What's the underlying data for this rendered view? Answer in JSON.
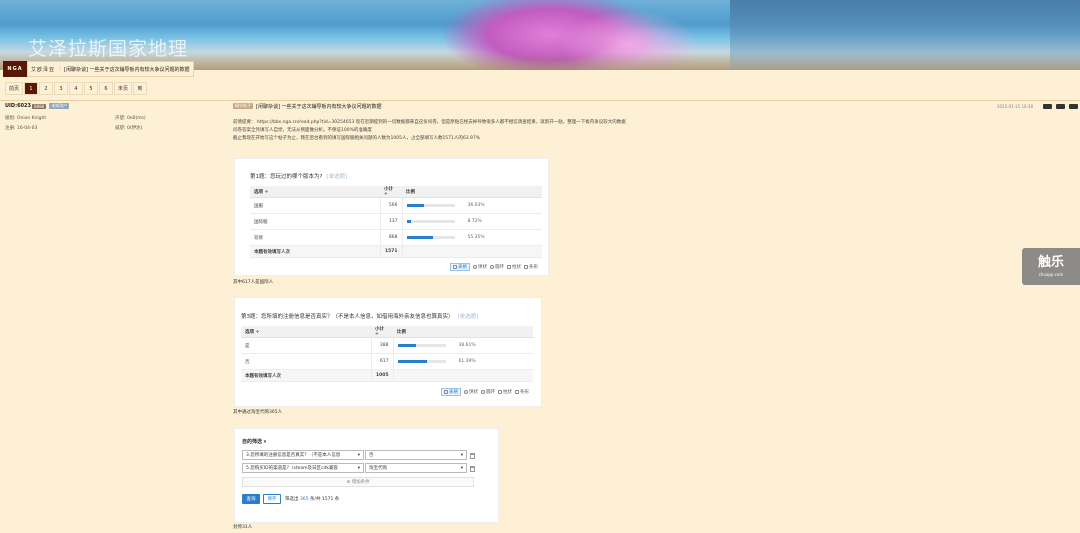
{
  "banner": {
    "site_title": "艾泽拉斯国家地理"
  },
  "header": {
    "logo": "NGA",
    "forum": "艾欧泽亚",
    "thread_title": "[闲聊杂谈] 一些关于这次辅导板内有较大争议问题的数据"
  },
  "pager": {
    "first": "前页",
    "pages": [
      "1",
      "2",
      "3",
      "4",
      "5",
      "6"
    ],
    "last": "末页",
    "to": "到"
  },
  "user": {
    "uid": "UID:6023",
    "badge": "8888",
    "badge2": "未知用户",
    "fields": [
      {
        "k": "级别",
        "v": "Onion Knight"
      },
      {
        "k": "声望",
        "v": "0e0(ms)"
      },
      {
        "k": "注册",
        "v": "16-04-03"
      },
      {
        "k": "威望",
        "v": "0(伊达)"
      }
    ]
  },
  "post": {
    "tag": "精华帖子",
    "title": "[闲聊杂谈] 一些关于这次辅导板内有较大争议问题的数据",
    "date": "2022-01-15 16:38",
    "lines": [
      "前情提要： https://bbs.nga.cn/read.php?tid=30254653 现在近期提到的一切数据都来自这份问卷。但是原贴已经去掉导致很多人都不相信调查结果，就新开一贴，整理一下板内争议较大的数据",
      "问卷答案全凭填写人自觉，无法从侧面做分析。不保证100%的准确度",
      "截止我现在开始写这个帖子为止，我在后台看到的填写国际服相关问题的人数为1005人，占全部填写人数1571人的63.97%"
    ]
  },
  "poll1": {
    "question": "第1题：您玩过的哪个版本为?",
    "kind": "[单选题]",
    "headers": [
      "选项 ÷",
      "小计 ÷",
      "比例"
    ],
    "rows": [
      {
        "option": "国服",
        "count": "566",
        "pct": "36.03%",
        "ratio": 0.3603
      },
      {
        "option": "国际服",
        "count": "137",
        "pct": "8.72%",
        "ratio": 0.0872
      },
      {
        "option": "双修",
        "count": "868",
        "pct": "55.25%",
        "ratio": 0.5525
      }
    ],
    "total_label": "本题有效填写人次",
    "total": "1571",
    "views": [
      "表格",
      "饼状",
      "圆环",
      "柱状",
      "条形"
    ]
  },
  "note1": "其中617人是国际人",
  "poll2": {
    "question": "第3题：您所填的注册信息是否真实？（不是本人信息，如借用海外亲友信息也算真实）",
    "kind": "[单选题]",
    "headers": [
      "选项 ÷",
      "小计 ÷",
      "比例"
    ],
    "rows": [
      {
        "option": "是",
        "count": "388",
        "pct": "38.61%",
        "ratio": 0.3861
      },
      {
        "option": "否",
        "count": "617",
        "pct": "61.39%",
        "ratio": 0.6139
      }
    ],
    "total_label": "本题有效填写人次",
    "total": "1005",
    "views": [
      "表格",
      "饼状",
      "圆环",
      "柱状",
      "条形"
    ]
  },
  "note2": "其中通过淘宝代购365人",
  "filter": {
    "title": "自的筛选 ▾",
    "cond1_q": "3.您所填的注册信息是否真实？（不是本人信息",
    "cond1_a": "否",
    "cond2_q": "5.您购买ID的渠道是?（steam及日区cdk兼容",
    "cond2_a": "淘宝代购",
    "add": "⊕ 增加条件",
    "query": "查询",
    "save": "保存",
    "count_prefix": "筛选出",
    "count_value": "365",
    "count_suffix": "条/共 1571 条"
  },
  "note3": "封停31人",
  "watermark": {
    "big": "触乐",
    "small": "chuapp.com"
  }
}
